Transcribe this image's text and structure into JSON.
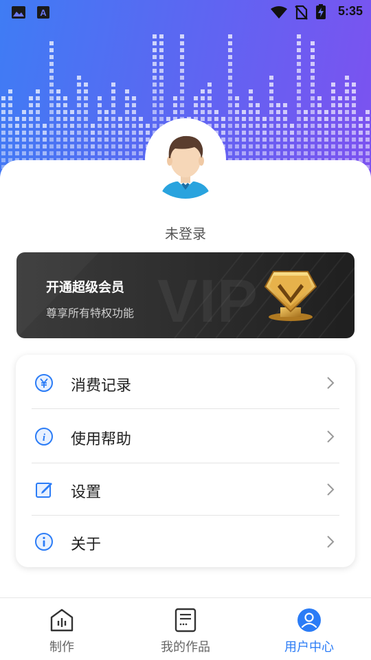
{
  "status_bar": {
    "time": "5:35",
    "icons": [
      "image-notification-icon",
      "text-notification-icon",
      "wifi-icon",
      "no-sim-icon",
      "battery-charging-icon"
    ]
  },
  "profile": {
    "login_status": "未登录",
    "avatar_icon": "default-avatar-icon"
  },
  "vip_card": {
    "title": "开通超级会员",
    "subtitle": "尊享所有特权功能",
    "watermark": "VIP",
    "badge_icon": "vip-crown-badge-icon"
  },
  "menu": {
    "items": [
      {
        "label": "消费记录",
        "icon": "yuan-icon"
      },
      {
        "label": "使用帮助",
        "icon": "info-icon"
      },
      {
        "label": "设置",
        "icon": "edit-icon"
      },
      {
        "label": "关于",
        "icon": "about-icon"
      }
    ]
  },
  "bottom_nav": {
    "items": [
      {
        "label": "制作",
        "icon": "home-chart-icon",
        "active": false
      },
      {
        "label": "我的作品",
        "icon": "document-icon",
        "active": false
      },
      {
        "label": "用户中心",
        "icon": "user-icon",
        "active": true
      }
    ]
  },
  "colors": {
    "accent": "#2b7cf6",
    "hero_start": "#3f7cf4",
    "hero_end": "#7c52f0",
    "vip_card": "#2c2c2c",
    "vip_gold": "#d8a53a"
  }
}
